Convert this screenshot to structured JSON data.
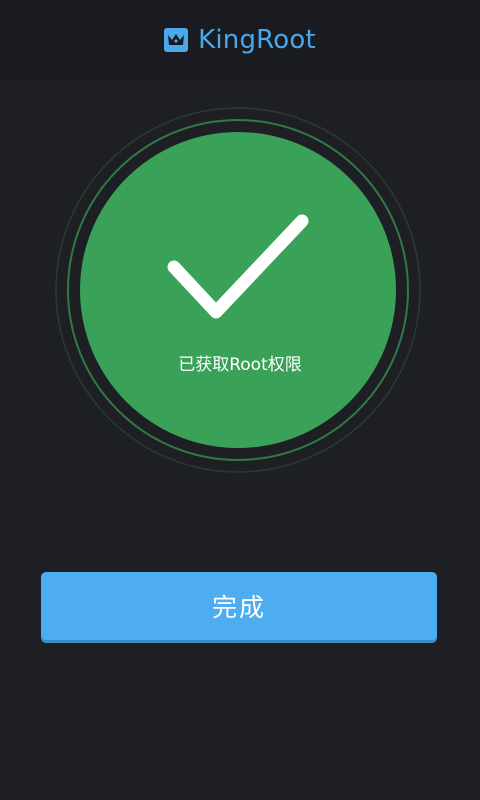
{
  "header": {
    "title": "KingRoot",
    "logo_icon": "crown-shield-icon"
  },
  "result": {
    "status_text": "已获取Root权限",
    "status_icon": "checkmark-icon",
    "circle_color": "#3aa158",
    "ring_color": "#2f7a45"
  },
  "actions": {
    "done_label": "完成",
    "button_color": "#4eacf0"
  },
  "colors": {
    "background": "#1e1f25",
    "header_background": "#1a1b20",
    "accent": "#4aa8ea"
  }
}
